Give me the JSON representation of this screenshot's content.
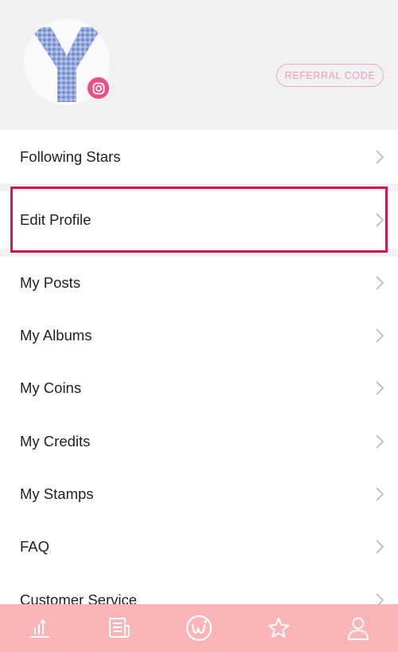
{
  "header": {
    "avatar_icon": "instagram-icon",
    "referral_label": "REFERRAL CODE"
  },
  "menu": {
    "items": [
      {
        "label": "Following Stars"
      },
      {
        "label": "Edit Profile"
      },
      {
        "label": "My Posts"
      },
      {
        "label": "My Albums"
      },
      {
        "label": "My Coins"
      },
      {
        "label": "My Credits"
      },
      {
        "label": "My Stamps"
      },
      {
        "label": "FAQ"
      },
      {
        "label": "Customer Service"
      }
    ]
  },
  "tabbar": {
    "tabs": [
      {
        "icon": "ranking-chart-icon"
      },
      {
        "icon": "news-icon"
      },
      {
        "icon": "app-logo-icon"
      },
      {
        "icon": "star-icon"
      },
      {
        "icon": "profile-icon"
      }
    ]
  },
  "colors": {
    "header_bg": "#f1f1f3",
    "accent_pink": "#ea4f84",
    "tabbar_bg": "#fbb5b8",
    "highlight_border": "#d5164a"
  }
}
